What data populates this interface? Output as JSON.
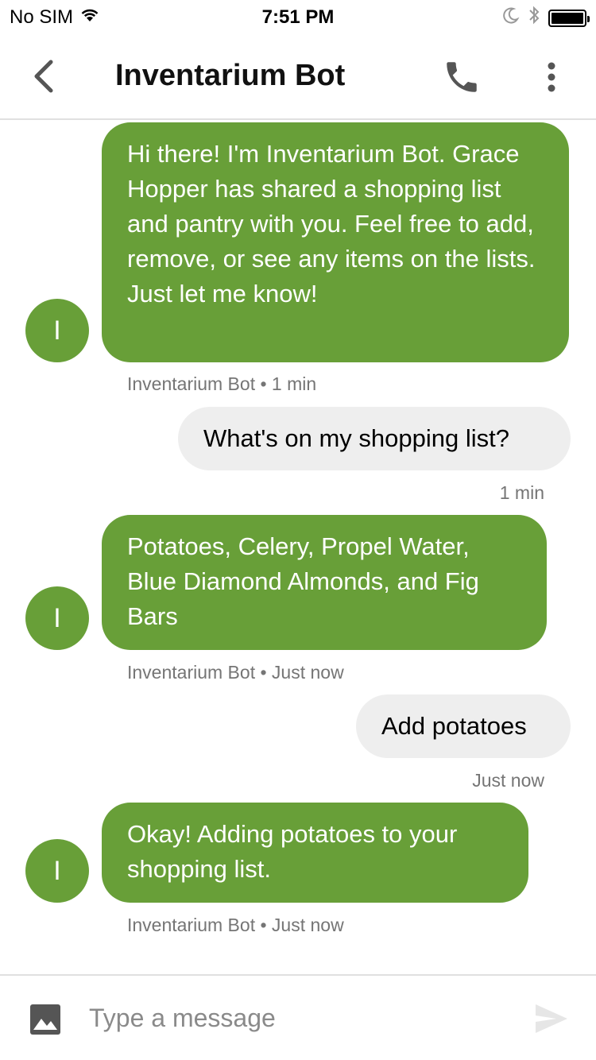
{
  "status_bar": {
    "carrier": "No SIM",
    "time": "7:51 PM",
    "icons": [
      "wifi-icon",
      "moon-icon",
      "bluetooth-icon",
      "battery-icon"
    ]
  },
  "header": {
    "title": "Inventarium Bot",
    "icons": [
      "back-icon",
      "phone-icon",
      "more-vertical-icon"
    ]
  },
  "messages": [
    {
      "from": "bot",
      "avatar_letter": "I",
      "text": "Hi there! I'm Inventarium Bot. Grace Hopper has shared a shopping list and pantry with you. Feel free to add, remove, or see any items on the lists. Just let me know!",
      "meta": "Inventarium Bot • 1 min"
    },
    {
      "from": "user",
      "text": "What's on my shopping list?",
      "meta": "1 min"
    },
    {
      "from": "bot",
      "avatar_letter": "I",
      "text": "Potatoes, Celery, Propel Water, Blue Diamond Almonds, and Fig Bars",
      "meta": "Inventarium Bot • Just now"
    },
    {
      "from": "user",
      "text": "Add potatoes",
      "meta": "Just now"
    },
    {
      "from": "bot",
      "avatar_letter": "I",
      "text": "Okay! Adding potatoes to your shopping list.",
      "meta": "Inventarium Bot • Just now"
    }
  ],
  "composer": {
    "placeholder": "Type a message",
    "value": ""
  },
  "colors": {
    "bot_bubble": "#689f38",
    "user_bubble": "#eeeeee",
    "meta_text": "#757575"
  }
}
